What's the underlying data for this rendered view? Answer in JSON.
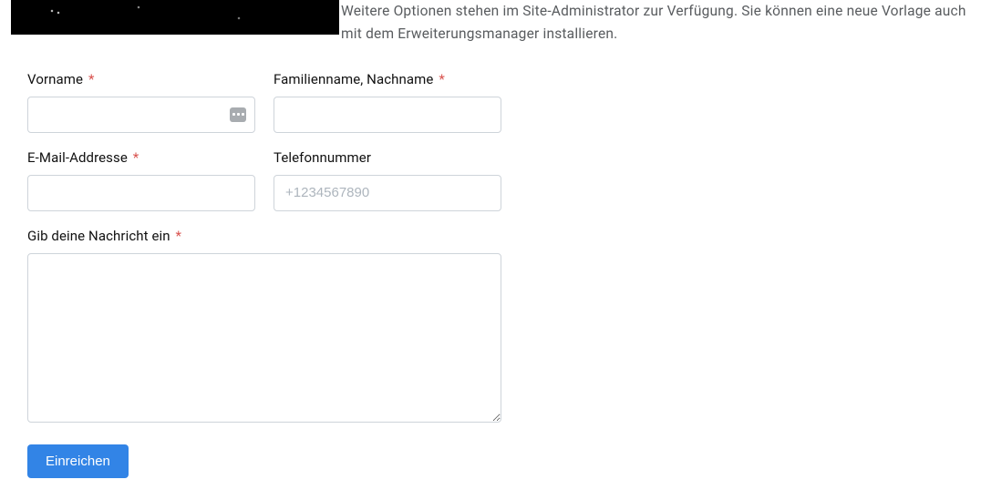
{
  "intro": {
    "text": "Weitere Optionen stehen im Site-Administrator zur Verfügung. Sie können eine neue Vorlage auch mit dem Erweiterungsmanager installieren."
  },
  "form": {
    "first_name": {
      "label": "Vorname",
      "required_mark": "*"
    },
    "last_name": {
      "label": "Familienname, Nachname",
      "required_mark": "*"
    },
    "email": {
      "label": "E-Mail-Addresse",
      "required_mark": "*"
    },
    "phone": {
      "label": "Telefonnummer",
      "placeholder": "+1234567890"
    },
    "message": {
      "label": "Gib deine Nachricht ein",
      "required_mark": "*"
    },
    "submit": {
      "label": "Einreichen"
    }
  }
}
